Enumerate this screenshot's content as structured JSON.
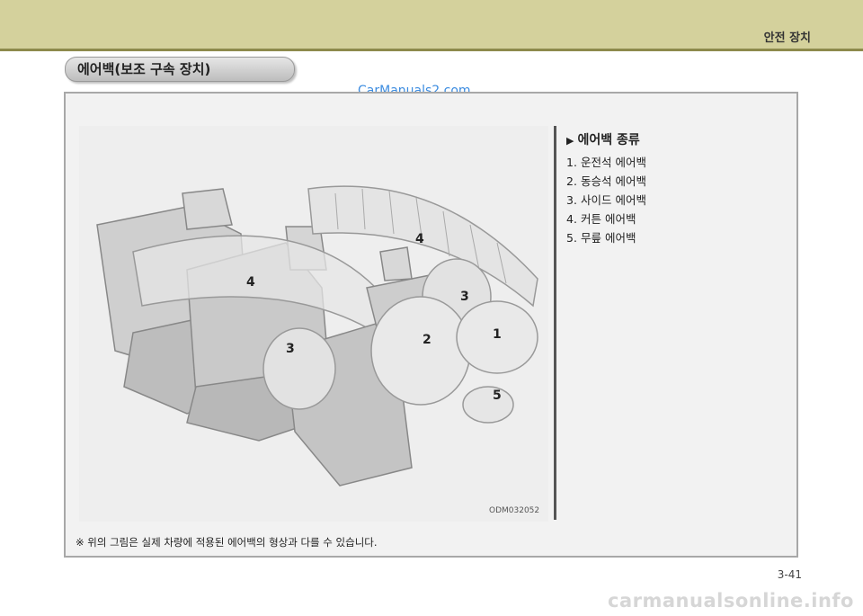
{
  "header": {
    "section_title": "안전 장치"
  },
  "heading": "에어백(보조 구속 장치)",
  "watermark_top": "CarManuals2.com",
  "figure": {
    "code": "ODM032052",
    "labels": [
      "4",
      "4",
      "3",
      "3",
      "2",
      "1",
      "5"
    ]
  },
  "types": {
    "title": "에어백 종류",
    "items": [
      {
        "num": "1.",
        "label": "운전석 에어백"
      },
      {
        "num": "2.",
        "label": "동승석 에어백"
      },
      {
        "num": "3.",
        "label": "사이드 에어백"
      },
      {
        "num": "4.",
        "label": "커튼 에어백"
      },
      {
        "num": "5.",
        "label": "무릎 에어백"
      }
    ]
  },
  "note": "※ 위의 그림은 실제 차량에 적용된 에어백의 형상과 다를 수 있습니다.",
  "page_number": "3-41",
  "watermark_bottom": "carmanualsonline.info"
}
